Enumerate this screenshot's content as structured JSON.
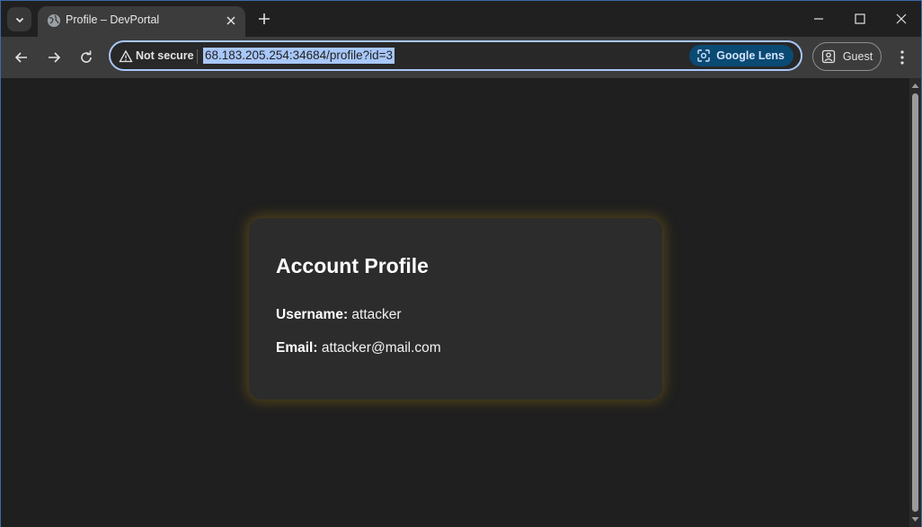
{
  "browser": {
    "tab": {
      "title": "Profile – DevPortal"
    },
    "address_bar": {
      "security_label": "Not secure",
      "url": "68.183.205.254:34684/profile?id=3",
      "lens_label": "Google Lens"
    },
    "profile_label": "Guest"
  },
  "page": {
    "heading": "Account Profile",
    "username_label": "Username:",
    "username_value": " attacker",
    "email_label": "Email:",
    "email_value": " attacker@mail.com"
  },
  "colors": {
    "card_bg": "#2c2c2c",
    "card_glow": "#7a6014",
    "page_bg": "#1f1f1f",
    "omnibox_focus": "#a8c7fa"
  }
}
